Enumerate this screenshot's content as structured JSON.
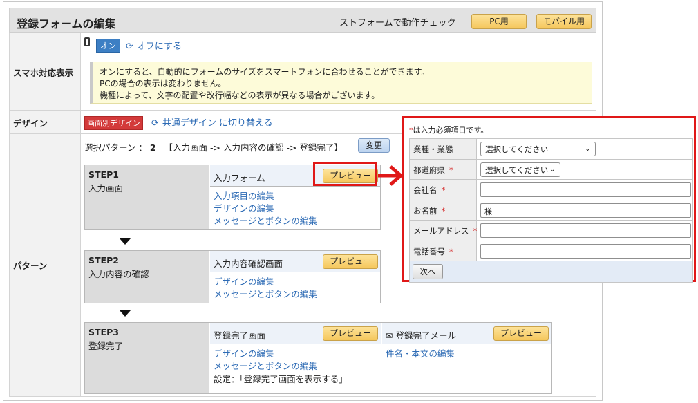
{
  "header": {
    "title": "登録フォームの編集",
    "note": "ストフォームで動作チェック",
    "pc_label": "PC用",
    "mobile_label": "モバイル用"
  },
  "smartphone": {
    "label": "スマホ対応表示",
    "on_badge": "オン",
    "off_link": "オフにする",
    "notes": [
      "オンにすると、自動的にフォームのサイズをスマートフォンに合わせることができます。",
      "PCの場合の表示は変わりません。",
      "機種によって、文字の配置や改行幅などの表示が異なる場合がございます。"
    ]
  },
  "design": {
    "label": "デザイン",
    "badge": "画面別デザイン",
    "switch_link": "共通デザイン に切り替える"
  },
  "pattern": {
    "label": "パターン",
    "select_label": "選択パターン ：",
    "select_value": "2",
    "flow": "【入力画面 -> 入力内容の確認 -> 登録完了】",
    "change_label": "変更",
    "preview_label": "プレビュー",
    "steps": [
      {
        "step": "STEP1",
        "name": "入力画面",
        "header": "入力フォーム",
        "links": [
          "入力項目の編集",
          "デザインの編集",
          "メッセージとボタンの編集"
        ]
      },
      {
        "step": "STEP2",
        "name": "入力内容の確認",
        "header": "入力内容確認画面",
        "links": [
          "デザインの編集",
          "メッセージとボタンの編集"
        ]
      },
      {
        "step": "STEP3",
        "name": "登録完了",
        "header": "登録完了画面",
        "links": [
          "デザインの編集",
          "メッセージとボタンの編集"
        ],
        "setting": "設定：「登録完了画面を表示する」",
        "mail_header": "登録完了メール",
        "mail_links": [
          "件名・本文の編集"
        ]
      }
    ]
  },
  "preview_form": {
    "required_note_mark": "*",
    "required_note": "は入力必須項目です。",
    "fields": [
      {
        "label": "業種・業態",
        "required": "",
        "type": "select",
        "value": "選択してください"
      },
      {
        "label": "都道府県",
        "required": "*",
        "type": "select",
        "value": "選択してください"
      },
      {
        "label": "会社名",
        "required": "*",
        "type": "text",
        "value": ""
      },
      {
        "label": "お名前",
        "required": "*",
        "type": "text",
        "value": "様"
      },
      {
        "label": "メールアドレス",
        "required": "*",
        "type": "text",
        "value": ""
      },
      {
        "label": "電話番号",
        "required": "*",
        "type": "text",
        "value": ""
      }
    ],
    "next_label": "次へ"
  },
  "colors": {
    "highlight": "#e01818",
    "link": "#2d6bb5",
    "on_badge": "#3d7fc4",
    "design_badge": "#d33a3a"
  }
}
